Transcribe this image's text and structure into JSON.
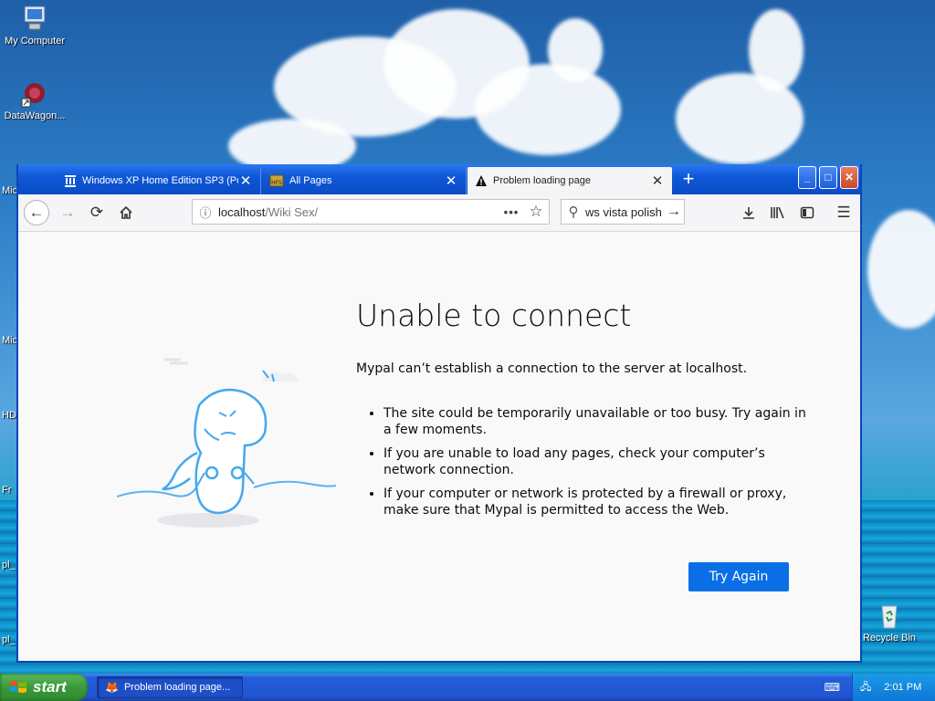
{
  "desktop": {
    "icons": [
      {
        "label": "My Computer",
        "icon": "computer-icon"
      },
      {
        "label": "DataWagon...",
        "icon": "datawagon-icon"
      },
      {
        "label": "Recycle Bin",
        "icon": "recycle-bin-icon"
      }
    ],
    "partial_labels": [
      "Mic",
      "Mic",
      "HD",
      "Fr",
      "pl_",
      "pl_"
    ]
  },
  "browser": {
    "tabs": [
      {
        "title": "Windows XP Home Edition SP3 (Po",
        "icon": "library-icon",
        "active": false
      },
      {
        "title": "All Pages",
        "icon": "hfs-icon",
        "active": false
      },
      {
        "title": "Problem loading page",
        "icon": "warning-icon",
        "active": true
      }
    ],
    "new_tab": "+",
    "window_buttons": {
      "minimize": "_",
      "maximize": "□",
      "close": "✕"
    },
    "url": {
      "host": "localhost",
      "path": "/Wiki Sex/"
    },
    "search_text": "ws vista polish",
    "error": {
      "title": "Unable to connect",
      "description": "Mypal can’t establish a connection to the server at localhost.",
      "bullets": [
        "The site could be temporarily unavailable or too busy. Try again in a few moments.",
        "If you are unable to load any pages, check your computer’s network connection.",
        "If your computer or network is protected by a firewall or proxy, make sure that Mypal is permitted to access the Web."
      ],
      "button": "Try Again"
    }
  },
  "taskbar": {
    "start_label": "start",
    "task_item": "Problem loading page...",
    "clock": "2:01 PM"
  },
  "colors": {
    "accent": "#0a6ee6",
    "titlebar": "#0f58d8",
    "start": "#3b9a3b"
  }
}
